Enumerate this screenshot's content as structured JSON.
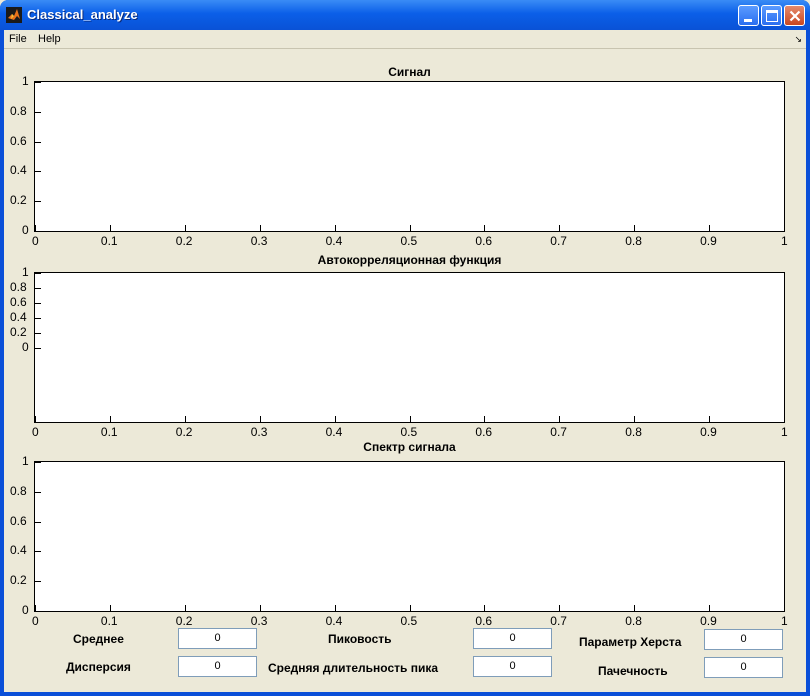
{
  "window": {
    "title": "Classical_analyze"
  },
  "menu": {
    "items": [
      "File",
      "Help"
    ],
    "dock_icon": "dock-arrow-icon",
    "dock_glyph": "↘"
  },
  "charts": [
    {
      "title": "Сигнал",
      "yticks": [
        "1",
        "0.8",
        "0.6",
        "0.4",
        "0.2",
        "0"
      ],
      "xticks": [
        "0",
        "0.1",
        "0.2",
        "0.3",
        "0.4",
        "0.5",
        "0.6",
        "0.7",
        "0.8",
        "0.9",
        "1"
      ]
    },
    {
      "title": "Автокорреляционная функция",
      "yticks": [
        "1",
        "0.8",
        "0.6",
        "0.4",
        "0.2",
        "0"
      ],
      "xticks": [
        "0",
        "0.1",
        "0.2",
        "0.3",
        "0.4",
        "0.5",
        "0.6",
        "0.7",
        "0.8",
        "0.9",
        "1"
      ]
    },
    {
      "title": "Спектр сигнала",
      "yticks": [
        "1",
        "0.8",
        "0.6",
        "0.4",
        "0.2",
        "0"
      ],
      "xticks": [
        "0",
        "0.1",
        "0.2",
        "0.3",
        "0.4",
        "0.5",
        "0.6",
        "0.7",
        "0.8",
        "0.9",
        "1"
      ]
    }
  ],
  "chart_data": [
    {
      "type": "line",
      "title": "Сигнал",
      "xlim": [
        0,
        1
      ],
      "ylim": [
        0,
        1
      ],
      "series": []
    },
    {
      "type": "line",
      "title": "Автокорреляционная функция",
      "xlim": [
        0,
        1
      ],
      "ylim": [
        0,
        1
      ],
      "series": []
    },
    {
      "type": "line",
      "title": "Спектр сигнала",
      "xlim": [
        0,
        1
      ],
      "ylim": [
        0,
        1
      ],
      "series": []
    }
  ],
  "stats": {
    "mean": {
      "label": "Среднее",
      "value": "0"
    },
    "variance": {
      "label": "Дисперсия",
      "value": "0"
    },
    "peakiness": {
      "label": "Пиковость",
      "value": "0"
    },
    "mean_peak_duration": {
      "label": "Средняя длительность пика",
      "value": "0"
    },
    "hurst": {
      "label": "Параметр Херста",
      "value": "0"
    },
    "burstiness": {
      "label": "Пачечность",
      "value": "0"
    }
  },
  "colors": {
    "titlebar": "#0b5fe8",
    "face": "#ece9d8",
    "axes_bg": "#ffffff"
  }
}
